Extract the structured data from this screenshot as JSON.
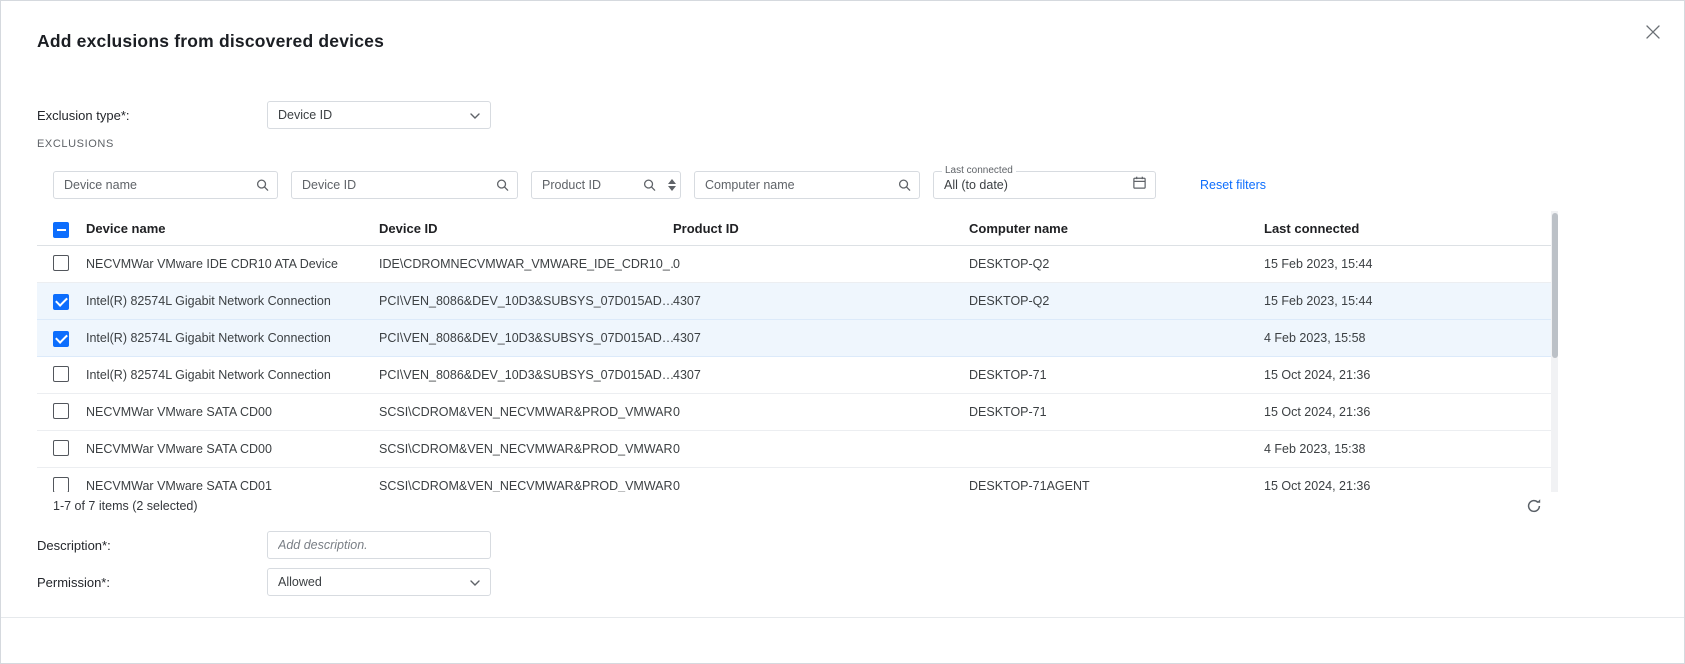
{
  "dialog": {
    "title": "Add exclusions from discovered devices"
  },
  "form": {
    "exclusion_type": {
      "label": "Exclusion type*:",
      "value": "Device ID"
    },
    "section_label": "EXCLUSIONS",
    "description": {
      "label": "Description*:",
      "placeholder": "Add description."
    },
    "permission": {
      "label": "Permission*:",
      "value": "Allowed"
    }
  },
  "filters": {
    "device_name": {
      "placeholder": "Device name"
    },
    "device_id": {
      "placeholder": "Device ID"
    },
    "product_id": {
      "placeholder": "Product ID"
    },
    "computer_name": {
      "placeholder": "Computer name"
    },
    "last_connected": {
      "label": "Last connected",
      "value": "All (to date)"
    },
    "reset_label": "Reset filters"
  },
  "table": {
    "columns": [
      "Device name",
      "Device ID",
      "Product ID",
      "Computer name",
      "Last connected"
    ],
    "select_all_state": "indeterminate",
    "rows": [
      {
        "checked": false,
        "device_name": "NECVMWar VMware IDE CDR10 ATA Device",
        "device_id": "IDE\\CDROMNECVMWAR_VMWARE_IDE_CDR10_…",
        "product_id": "0",
        "computer_name": "DESKTOP-Q2",
        "last_connected": "15 Feb 2023, 15:44"
      },
      {
        "checked": true,
        "device_name": "Intel(R) 82574L Gigabit Network Connection",
        "device_id": "PCI\\VEN_8086&DEV_10D3&SUBSYS_07D015AD…",
        "product_id": "4307",
        "computer_name": "DESKTOP-Q2",
        "last_connected": "15 Feb 2023, 15:44"
      },
      {
        "checked": true,
        "device_name": "Intel(R) 82574L Gigabit Network Connection",
        "device_id": "PCI\\VEN_8086&DEV_10D3&SUBSYS_07D015AD…",
        "product_id": "4307",
        "computer_name": "",
        "last_connected": "4 Feb 2023, 15:58"
      },
      {
        "checked": false,
        "device_name": "Intel(R) 82574L Gigabit Network Connection",
        "device_id": "PCI\\VEN_8086&DEV_10D3&SUBSYS_07D015AD…",
        "product_id": "4307",
        "computer_name": "DESKTOP-71",
        "last_connected": "15 Oct 2024, 21:36"
      },
      {
        "checked": false,
        "device_name": "NECVMWar VMware SATA CD00",
        "device_id": "SCSI\\CDROM&VEN_NECVMWAR&PROD_VMWAR…",
        "product_id": "0",
        "computer_name": "DESKTOP-71",
        "last_connected": "15 Oct 2024, 21:36"
      },
      {
        "checked": false,
        "device_name": "NECVMWar VMware SATA CD00",
        "device_id": "SCSI\\CDROM&VEN_NECVMWAR&PROD_VMWAR…",
        "product_id": "0",
        "computer_name": "",
        "last_connected": "4 Feb 2023, 15:38"
      },
      {
        "checked": false,
        "device_name": "NECVMWar VMware SATA CD01",
        "device_id": "SCSI\\CDROM&VEN_NECVMWAR&PROD_VMWAR…",
        "product_id": "0",
        "computer_name": "DESKTOP-71AGENT",
        "last_connected": "15 Oct 2024, 21:36"
      }
    ]
  },
  "footer": {
    "items_text": "1-7 of 7 items (2 selected)"
  },
  "colors": {
    "accent": "#0d6efd",
    "selected_row_bg": "#eff6fd"
  }
}
